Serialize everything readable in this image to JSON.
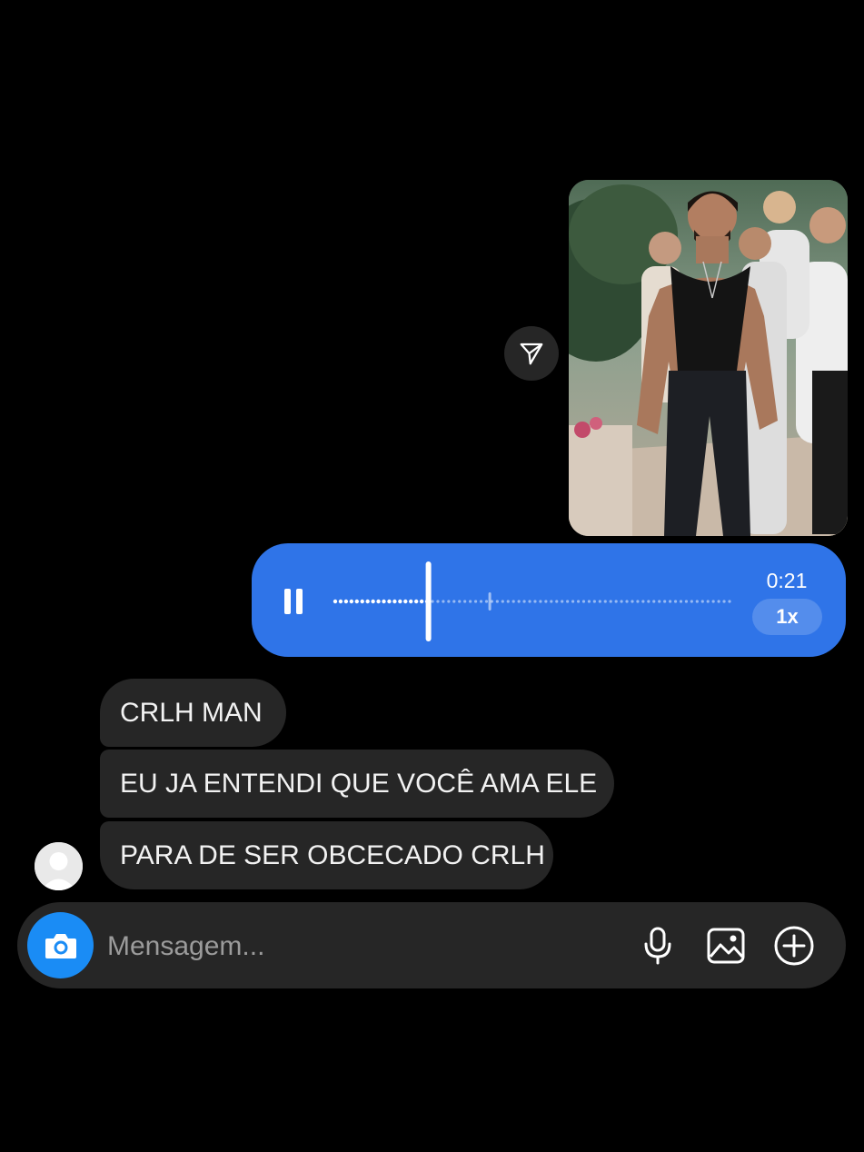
{
  "thread": {
    "shared_post": {
      "image_alt": "Homem de regata preta caminhando",
      "share_icon": "send-icon"
    },
    "voice_message": {
      "duration": "0:21",
      "playback_speed": "1x",
      "state": "playing",
      "progress": 0.24,
      "accent_color": "#2f74e8"
    },
    "received_messages": [
      {
        "text": "CRLH MAN"
      },
      {
        "text": "EU JA ENTENDI QUE VOCÊ AMA ELE"
      },
      {
        "text": "PARA DE SER OBCECADO CRLH"
      }
    ]
  },
  "composer": {
    "placeholder": "Mensagem...",
    "camera_icon": "camera-icon",
    "camera_color": "#1a8cf5",
    "icons": [
      "microphone-icon",
      "image-icon",
      "plus-circle-icon"
    ]
  }
}
